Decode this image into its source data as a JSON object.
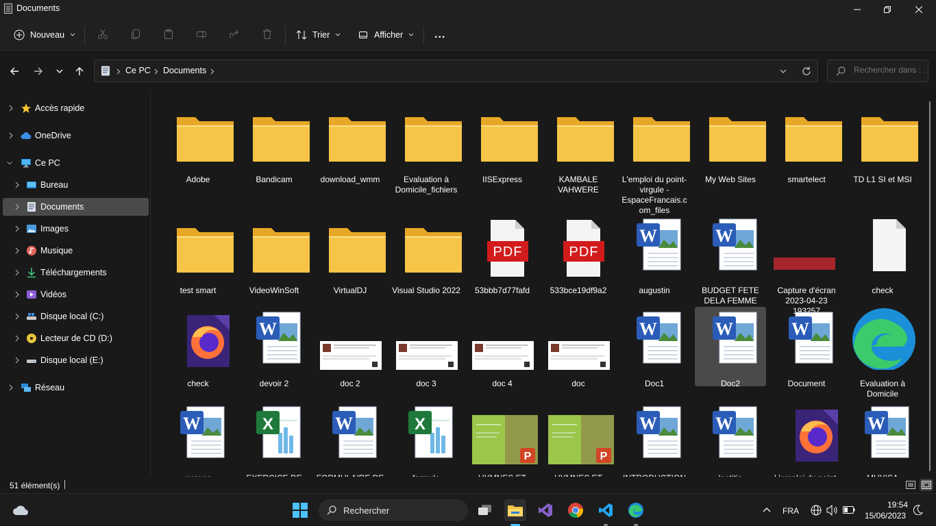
{
  "window": {
    "title": "Documents"
  },
  "toolbar": {
    "new_label": "Nouveau",
    "sort_label": "Trier",
    "view_label": "Afficher",
    "more_label": "..."
  },
  "address": {
    "crumbs": [
      "Ce PC",
      "Documents"
    ],
    "search_placeholder": "Rechercher dans : ..."
  },
  "sidebar": {
    "items": [
      {
        "label": "Accès rapide",
        "icon": "star-icon"
      },
      {
        "label": "OneDrive",
        "icon": "cloud-icon"
      },
      {
        "label": "Ce PC",
        "icon": "computer-icon"
      },
      {
        "label": "Bureau",
        "icon": "desktop-icon"
      },
      {
        "label": "Documents",
        "icon": "documents-icon"
      },
      {
        "label": "Images",
        "icon": "images-icon"
      },
      {
        "label": "Musique",
        "icon": "music-icon"
      },
      {
        "label": "Téléchargements",
        "icon": "download-icon"
      },
      {
        "label": "Vidéos",
        "icon": "video-icon"
      },
      {
        "label": "Disque local (C:)",
        "icon": "drive-icon"
      },
      {
        "label": "Lecteur de CD (D:)",
        "icon": "cd-icon"
      },
      {
        "label": "Disque local (E:)",
        "icon": "drive-icon"
      },
      {
        "label": "Réseau",
        "icon": "network-icon"
      }
    ]
  },
  "files": [
    {
      "name": "Adobe",
      "type": "folder"
    },
    {
      "name": "Bandicam",
      "type": "folder"
    },
    {
      "name": "download_wmm",
      "type": "folder"
    },
    {
      "name": "Evaluation à Domicile_fichiers",
      "type": "folder"
    },
    {
      "name": "IISExpress",
      "type": "folder"
    },
    {
      "name": "KAMBALE VAHWERE",
      "type": "folder"
    },
    {
      "name": "L'emploi du point-virgule - EspaceFrancais.c om_files",
      "type": "folder"
    },
    {
      "name": "My Web Sites",
      "type": "folder"
    },
    {
      "name": "smartelect",
      "type": "folder"
    },
    {
      "name": "TD L1 SI et MSI",
      "type": "folder"
    },
    {
      "name": "test smart",
      "type": "folder"
    },
    {
      "name": "VideoWinSoft",
      "type": "folder"
    },
    {
      "name": "VirtualDJ",
      "type": "folder"
    },
    {
      "name": "Visual Studio 2022",
      "type": "folder"
    },
    {
      "name": "53bbb7d77fafd",
      "type": "pdf",
      "badge": "PDF"
    },
    {
      "name": "533bce19df9a2",
      "type": "pdf",
      "badge": "PDF"
    },
    {
      "name": "augustin",
      "type": "word"
    },
    {
      "name": "BUDGET FETE DELA FEMME",
      "type": "word"
    },
    {
      "name": "Capture d'écran 2023-04-23 193257",
      "type": "image"
    },
    {
      "name": "check",
      "type": "blank"
    },
    {
      "name": "check",
      "type": "firefox"
    },
    {
      "name": "devoir 2",
      "type": "word"
    },
    {
      "name": "doc 2",
      "type": "docthumb"
    },
    {
      "name": "doc 3",
      "type": "docthumb"
    },
    {
      "name": "doc 4",
      "type": "docthumb"
    },
    {
      "name": "doc",
      "type": "docthumb"
    },
    {
      "name": "Doc1",
      "type": "word"
    },
    {
      "name": "Doc2",
      "type": "word",
      "selected": true
    },
    {
      "name": "Document",
      "type": "word"
    },
    {
      "name": "Evaluation à Domicile",
      "type": "edge"
    },
    {
      "name": "exauce",
      "type": "word"
    },
    {
      "name": "EXERCICE DE BUREAUTIQUE",
      "type": "excel"
    },
    {
      "name": "FORMULAIRE DE SOUMISSION DE",
      "type": "word"
    },
    {
      "name": "formule",
      "type": "excel"
    },
    {
      "name": "HYMNES ET LOUANGES",
      "type": "ppt"
    },
    {
      "name": "HYMNES ET LOUANGES",
      "type": "ppt"
    },
    {
      "name": "INTRODUCTION TEC FABRICE",
      "type": "word"
    },
    {
      "name": "laetitia",
      "type": "word"
    },
    {
      "name": "L'emploi du point-virgule",
      "type": "firefox"
    },
    {
      "name": "MUYISA VAGHENI",
      "type": "word"
    }
  ],
  "status": {
    "count": "51 élément(s)"
  },
  "taskbar": {
    "search_label": "Rechercher",
    "language": "FRA",
    "time": "19:54",
    "date": "15/06/2023"
  },
  "colors": {
    "folder": "#f6c547",
    "folder_dark": "#e8a827",
    "word_blue": "#2b5cb8",
    "pdf_red": "#d21b1b",
    "excel_green": "#1e7a3c",
    "accent": "#4cc2ff"
  }
}
